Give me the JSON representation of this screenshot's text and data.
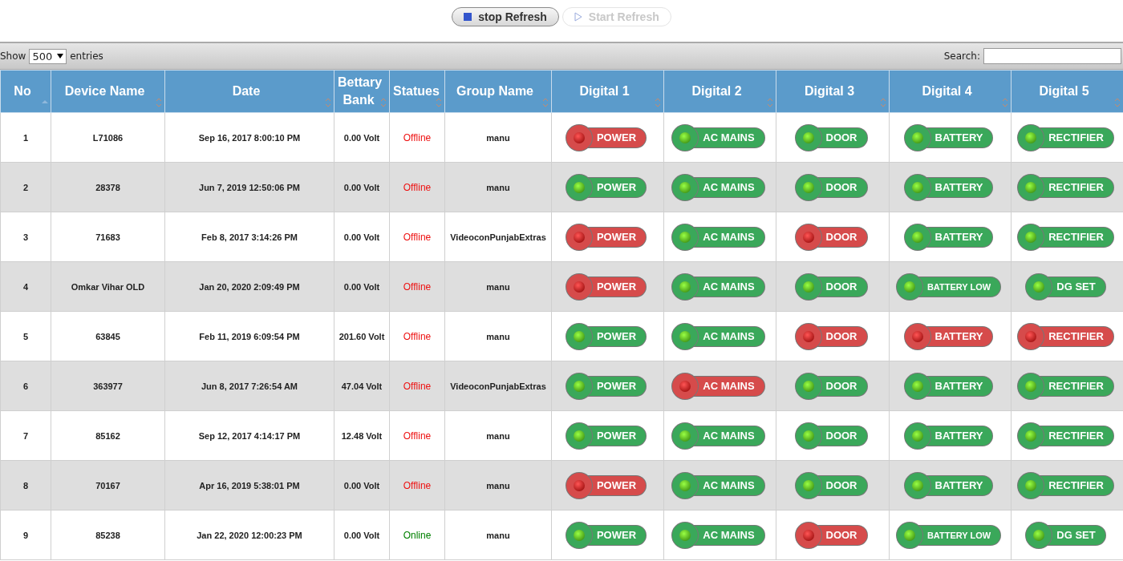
{
  "refresh_buttons": [
    {
      "label": "stop Refresh",
      "disabled": false
    },
    {
      "label": "Start Refresh",
      "disabled": true
    }
  ],
  "length_control": {
    "prefix": "Show",
    "value": "500",
    "suffix": "entries"
  },
  "search": {
    "label": "Search:"
  },
  "table": {
    "columns": [
      {
        "label": "No",
        "sorted": true
      },
      {
        "label": "Device Name",
        "sorted": false
      },
      {
        "label": "Date",
        "sorted": false
      },
      {
        "label": "Bettary Bank",
        "sorted": false
      },
      {
        "label": "Statues",
        "sorted": false
      },
      {
        "label": "Group Name",
        "sorted": false
      },
      {
        "label": "Digital 1",
        "sorted": false
      },
      {
        "label": "Digital 2",
        "sorted": false
      },
      {
        "label": "Digital 3",
        "sorted": false
      },
      {
        "label": "Digital 4",
        "sorted": false
      },
      {
        "label": "Digital 5",
        "sorted": false
      }
    ],
    "rows": [
      {
        "no": "1",
        "device": "L71086",
        "date": "Sep 16, 2017 8:00:10 PM",
        "battery": "0.00 Volt",
        "status": "Offline",
        "online": false,
        "group": "manu",
        "digitals": [
          {
            "label": "POWER",
            "ok": false
          },
          {
            "label": "AC MAINS",
            "ok": true
          },
          {
            "label": "DOOR",
            "ok": true
          },
          {
            "label": "BATTERY",
            "ok": true
          },
          {
            "label": "RECTIFIER",
            "ok": true
          }
        ]
      },
      {
        "no": "2",
        "device": "28378",
        "date": "Jun 7, 2019 12:50:06 PM",
        "battery": "0.00 Volt",
        "status": "Offline",
        "online": false,
        "group": "manu",
        "digitals": [
          {
            "label": "POWER",
            "ok": true
          },
          {
            "label": "AC MAINS",
            "ok": true
          },
          {
            "label": "DOOR",
            "ok": true
          },
          {
            "label": "BATTERY",
            "ok": true
          },
          {
            "label": "RECTIFIER",
            "ok": true
          }
        ]
      },
      {
        "no": "3",
        "device": "71683",
        "date": "Feb 8, 2017 3:14:26 PM",
        "battery": "0.00 Volt",
        "status": "Offline",
        "online": false,
        "group": "VideoconPunjabExtras",
        "digitals": [
          {
            "label": "POWER",
            "ok": false
          },
          {
            "label": "AC MAINS",
            "ok": true
          },
          {
            "label": "DOOR",
            "ok": false
          },
          {
            "label": "BATTERY",
            "ok": true
          },
          {
            "label": "RECTIFIER",
            "ok": true
          }
        ]
      },
      {
        "no": "4",
        "device": "Omkar Vihar OLD",
        "date": "Jan 20, 2020 2:09:49 PM",
        "battery": "0.00 Volt",
        "status": "Offline",
        "online": false,
        "group": "manu",
        "digitals": [
          {
            "label": "POWER",
            "ok": false
          },
          {
            "label": "AC MAINS",
            "ok": true
          },
          {
            "label": "DOOR",
            "ok": true
          },
          {
            "label": "BATTERY LOW",
            "ok": true
          },
          {
            "label": "DG SET",
            "ok": true
          }
        ]
      },
      {
        "no": "5",
        "device": "63845",
        "date": "Feb 11, 2019 6:09:54 PM",
        "battery": "201.60 Volt",
        "status": "Offline",
        "online": false,
        "group": "manu",
        "digitals": [
          {
            "label": "POWER",
            "ok": true
          },
          {
            "label": "AC MAINS",
            "ok": true
          },
          {
            "label": "DOOR",
            "ok": false
          },
          {
            "label": "BATTERY",
            "ok": false
          },
          {
            "label": "RECTIFIER",
            "ok": false
          }
        ]
      },
      {
        "no": "6",
        "device": "363977",
        "date": "Jun 8, 2017 7:26:54 AM",
        "battery": "47.04 Volt",
        "status": "Offline",
        "online": false,
        "group": "VideoconPunjabExtras",
        "digitals": [
          {
            "label": "POWER",
            "ok": true
          },
          {
            "label": "AC MAINS",
            "ok": false
          },
          {
            "label": "DOOR",
            "ok": true
          },
          {
            "label": "BATTERY",
            "ok": true
          },
          {
            "label": "RECTIFIER",
            "ok": true
          }
        ]
      },
      {
        "no": "7",
        "device": "85162",
        "date": "Sep 12, 2017 4:14:17 PM",
        "battery": "12.48 Volt",
        "status": "Offline",
        "online": false,
        "group": "manu",
        "digitals": [
          {
            "label": "POWER",
            "ok": true
          },
          {
            "label": "AC MAINS",
            "ok": true
          },
          {
            "label": "DOOR",
            "ok": true
          },
          {
            "label": "BATTERY",
            "ok": true
          },
          {
            "label": "RECTIFIER",
            "ok": true
          }
        ]
      },
      {
        "no": "8",
        "device": "70167",
        "date": "Apr 16, 2019 5:38:01 PM",
        "battery": "0.00 Volt",
        "status": "Offline",
        "online": false,
        "group": "manu",
        "digitals": [
          {
            "label": "POWER",
            "ok": false
          },
          {
            "label": "AC MAINS",
            "ok": true
          },
          {
            "label": "DOOR",
            "ok": true
          },
          {
            "label": "BATTERY",
            "ok": true
          },
          {
            "label": "RECTIFIER",
            "ok": true
          }
        ]
      },
      {
        "no": "9",
        "device": "85238",
        "date": "Jan 22, 2020 12:00:23 PM",
        "battery": "0.00 Volt",
        "status": "Online",
        "online": true,
        "group": "manu",
        "digitals": [
          {
            "label": "POWER",
            "ok": true
          },
          {
            "label": "AC MAINS",
            "ok": true
          },
          {
            "label": "DOOR",
            "ok": false
          },
          {
            "label": "BATTERY LOW",
            "ok": true
          },
          {
            "label": "DG SET",
            "ok": true
          }
        ]
      }
    ]
  }
}
